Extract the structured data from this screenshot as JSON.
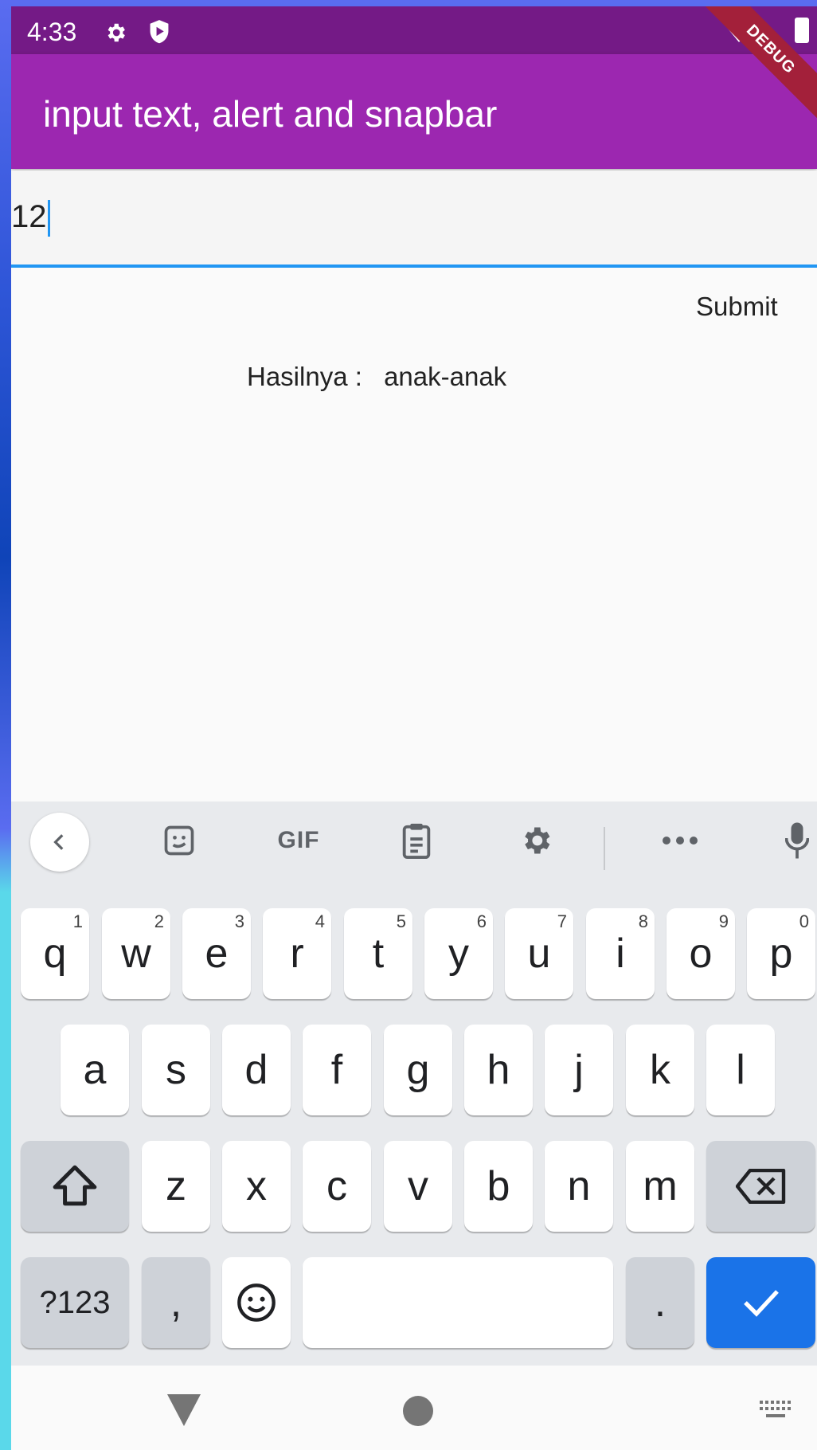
{
  "status_bar": {
    "time": "4:33"
  },
  "debug_banner": "DEBUG",
  "app_bar": {
    "title": "input text, alert and snapbar"
  },
  "input": {
    "value": "12"
  },
  "submit_label": "Submit",
  "result": {
    "label": "Hasilnya :",
    "value": "anak-anak"
  },
  "keyboard": {
    "toolbar": {
      "gif_label": "GIF"
    },
    "row1": [
      {
        "key": "q",
        "hint": "1"
      },
      {
        "key": "w",
        "hint": "2"
      },
      {
        "key": "e",
        "hint": "3"
      },
      {
        "key": "r",
        "hint": "4"
      },
      {
        "key": "t",
        "hint": "5"
      },
      {
        "key": "y",
        "hint": "6"
      },
      {
        "key": "u",
        "hint": "7"
      },
      {
        "key": "i",
        "hint": "8"
      },
      {
        "key": "o",
        "hint": "9"
      },
      {
        "key": "p",
        "hint": "0"
      }
    ],
    "row2": [
      "a",
      "s",
      "d",
      "f",
      "g",
      "h",
      "j",
      "k",
      "l"
    ],
    "row3": [
      "z",
      "x",
      "c",
      "v",
      "b",
      "n",
      "m"
    ],
    "symbols_label": "?123",
    "comma_label": ",",
    "period_label": "."
  },
  "colors": {
    "status_bar": "#741a86",
    "app_bar": "#9c27b0",
    "input_underline": "#2196f3",
    "enter_key": "#1a73e8",
    "debug_banner": "#a3203a"
  }
}
